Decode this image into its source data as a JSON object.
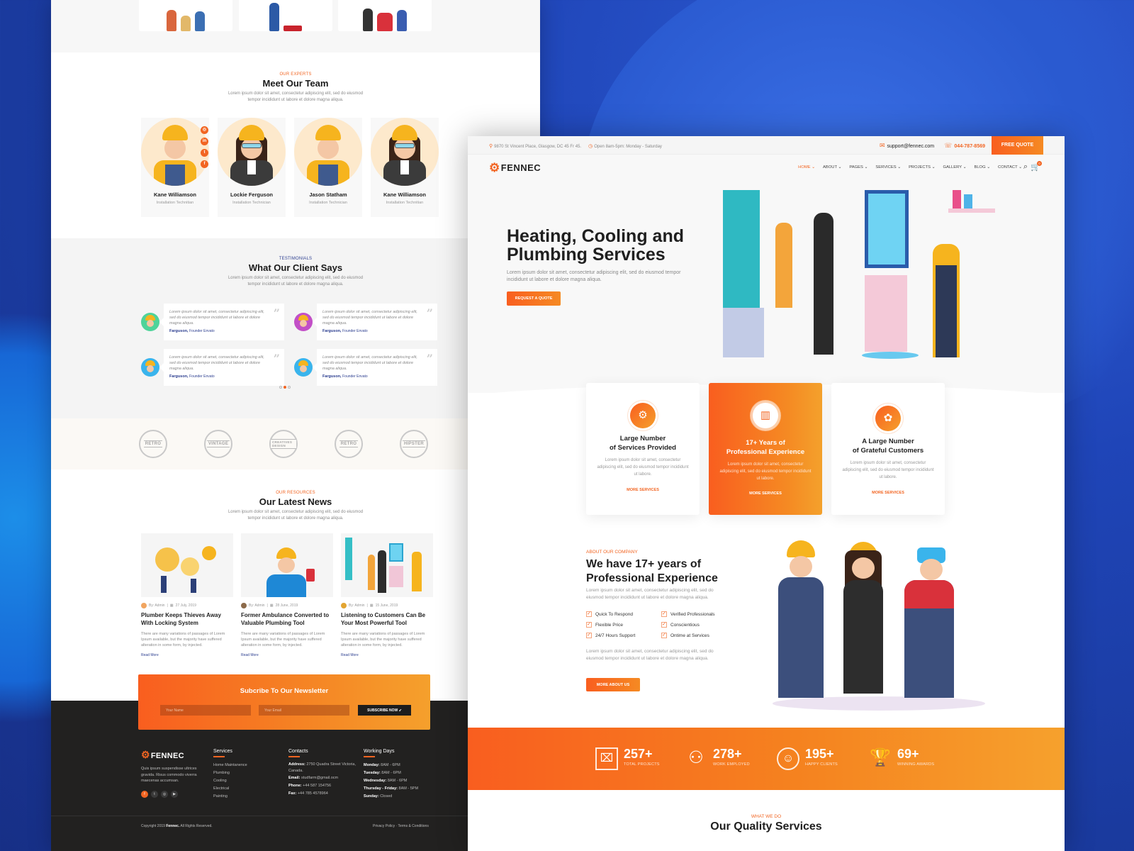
{
  "left_page": {
    "team": {
      "subtitle": "OUR EXPERTS",
      "title": "Meet Our Team",
      "description": "Lorem ipsum dolor sit amet, consectetur adipiscing elit, sed do eiusmod tempor incididunt ut labore et dolore magna aliqua.",
      "members": [
        {
          "name": "Kane Williamson",
          "role": "Installation Technitian"
        },
        {
          "name": "Lockie Ferguson",
          "role": "Installation Technician"
        },
        {
          "name": "Jason Statham",
          "role": "Installation Technician"
        },
        {
          "name": "Kane Williamson",
          "role": "Installation Technitian"
        }
      ],
      "social_icons": [
        "instagram-icon",
        "linkedin-icon",
        "twitter-icon",
        "facebook-icon"
      ]
    },
    "testimonials": {
      "subtitle": "TESTIMONIALS",
      "title": "What Our Client Says",
      "description": "Lorem ipsum dolor sit amet, consectetur adipiscing elit, sed do eiusmod tempor incididunt ut labore et dolore magna aliqua.",
      "items": [
        {
          "text": "Lorem ipsum dolor sit amet, consectetur adipiscing elit, sed do eiusmod tempor incididunt ut labore et dolore magna aliqua.",
          "author": "Farguson,",
          "company": "Founder Envato",
          "avatar_color": "#4fd39a"
        },
        {
          "text": "Lorem ipsum dolor sit amet, consectetur adipiscing elit, sed do eiusmod tempor incididunt ut labore et dolore magna aliqua.",
          "author": "Farguson,",
          "company": "Founder Envato",
          "avatar_color": "#c24fc7"
        },
        {
          "text": "Lorem ipsum dolor sit amet, consectetur adipiscing elit, sed do eiusmod tempor incididunt ut labore et dolore magna aliqua.",
          "author": "Farguson,",
          "company": "Founder Envato",
          "avatar_color": "#3ab4ec"
        },
        {
          "text": "Lorem ipsum dolor sit amet, consectetur adipiscing elit, sed do eiusmod tempor incididunt ut labore et dolore magna aliqua.",
          "author": "Farguson,",
          "company": "Founder Envato",
          "avatar_color": "#3ab4ec"
        }
      ],
      "quote_glyph": "99"
    },
    "brands": [
      "RETRO",
      "VINTAGE",
      "CREATIVES DESIGN",
      "RETRO",
      "HIPSTER"
    ],
    "news": {
      "subtitle": "OUR RESOURCES",
      "title": "Our Latest News",
      "description": "Lorem ipsum dolor sit amet, consectetur adipiscing elit, sed do eiusmod tempor incididunt ut labore et dolore magna aliqua.",
      "items": [
        {
          "author": "By: Admin",
          "date": "27 July, 2019",
          "title": "Plumber Keeps Thieves Away With Locking System",
          "excerpt": "There are many variations of passages of Lorem Ipsum available, but the majority have suffered alteration in some form, by injected.",
          "read_more": "Read More"
        },
        {
          "author": "By: Admin",
          "date": "28 June, 2019",
          "title": "Former Ambulance Converted to Valuable Plumbing Tool",
          "excerpt": "There are many variations of passages of Lorem Ipsum available, but the majority have suffered alteration in some form, by injected.",
          "read_more": "Read More"
        },
        {
          "author": "By: Admin",
          "date": "15 June, 2019",
          "title": "Listening to Customers Can Be Your Most Powerful Tool",
          "excerpt": "There are many variations of passages of Lorem Ipsum available, but the majority have suffered alteration in some form, by injected.",
          "read_more": "Read More"
        }
      ]
    },
    "newsletter": {
      "title": "Subcribe To Our Newsletter",
      "name_placeholder": "Your Name",
      "email_placeholder": "Your Email",
      "button": "SUBSCRIBE NOW"
    },
    "footer": {
      "logo": "FENNEC",
      "about": "Quis ipsum suspendisse ultrices gravida. Risus commodo viverra maecenas accumsan.",
      "social_icons": [
        "facebook-icon",
        "twitter-icon",
        "instagram-icon",
        "youtube-icon"
      ],
      "services_title": "Services",
      "services": [
        "Home Maintanence",
        "Plumbing",
        "Cooling",
        "Electrical",
        "Painting"
      ],
      "contacts_title": "Contacts",
      "contacts": [
        {
          "label": "Address:",
          "value": "2750 Quadra Street Victoria, Canada."
        },
        {
          "label": "Email:",
          "value": "studfarm@gmail.ocm"
        },
        {
          "label": "Phone:",
          "value": "+44 587 154756"
        },
        {
          "label": "Fax:",
          "value": "+44 785 4578964"
        }
      ],
      "working_title": "Working Days",
      "working": [
        {
          "label": "Monday:",
          "value": "8AM - 6PM"
        },
        {
          "label": "Tuesday:",
          "value": "8AM - 6PM"
        },
        {
          "label": "Wednesday:",
          "value": "8AM - 6PM"
        },
        {
          "label": "Thursday - Friday:",
          "value": "8AM - 5PM"
        },
        {
          "label": "Sunday:",
          "value": "Closed"
        }
      ],
      "copyright_prefix": "Copyright 2019",
      "copyright_brand": "Fennec.",
      "copyright_suffix": "All Rights Reserved.",
      "links": "Privacy Policy  ·  Terms & Conditions"
    }
  },
  "right_page": {
    "topbar": {
      "address": "9870 St Vincent Place, Glasgow, DC 45 Fr 45.",
      "hours": "Open 8am-5pm: Monday - Saturday",
      "email": "support@fennec.com",
      "phone": "044-787-8569",
      "quote_button": "FREE QUOTE"
    },
    "logo": "FENNEC",
    "nav": [
      "HOME",
      "ABOUT",
      "PAGES",
      "SERVICES",
      "PROJECTS",
      "GALLERY",
      "BLOG",
      "CONTACT"
    ],
    "nav_active": "HOME",
    "cart_count": "0",
    "hero": {
      "title_line1": "Heating, Cooling and",
      "title_line2": "Plumbing Services",
      "description": "Lorem ipsum dolor sit amet, consectetur adipiscing elit, sed do eiusmod tempor incididunt ut labore et dolore magna aliqua.",
      "button": "REQUEST A QUOTE"
    },
    "services": [
      {
        "title_line1": "Large Number",
        "title_line2": "of Services Provided",
        "description": "Lorem ipsum dolor sit amet, consectetur adipiscing elit, sed do eiusmod tempor incididunt ut labore.",
        "link": "MORE SERVICES",
        "icon": "gear-icon",
        "highlighted": false
      },
      {
        "title_line1": "17+ Years of",
        "title_line2": "Professional Experience",
        "description": "Lorem ipsum dolor sit amet, consectetur adipiscing elit, sed do eiusmod tempor incididunt ut labore.",
        "link": "MORE SERVICES",
        "icon": "building-check-icon",
        "highlighted": true
      },
      {
        "title_line1": "A Large Number",
        "title_line2": "of Grateful Customers",
        "description": "Lorem ipsum dolor sit amet, consectetur adipiscing elit, sed do eiusmod tempor incididunt ut labore.",
        "link": "MORE SERVICES",
        "icon": "hand-gear-icon",
        "highlighted": false
      }
    ],
    "about": {
      "subtitle": "ABOUT OUR COMPANY",
      "title_line1": "We have 17+ years of",
      "title_line2": "Professional Experience",
      "description1": "Lorem ipsum dolor sit amet, consectetur adipiscing elit, sed do eiusmod tempor incididunt ut labore et dolore magna aliqua.",
      "features": [
        "Quick To Respond",
        "Verified Professionals",
        "Flexible Price",
        "Conscientious",
        "24/7 Hours Support",
        "Ontime at Services"
      ],
      "description2": "Lorem ipsum dolor sit amet, consectetur adipiscing elit, sed do eiusmod tempor incididunt ut labore et dolore magna aliqua.",
      "button": "MORE ABOUT US"
    },
    "counters": [
      {
        "value": "257+",
        "label": "TOTAL PROJECTS",
        "icon": "briefcase-icon"
      },
      {
        "value": "278+",
        "label": "WORK EMPLOYED",
        "icon": "user-icon"
      },
      {
        "value": "195+",
        "label": "HAPPY CLIENTS",
        "icon": "smiley-icon"
      },
      {
        "value": "69+",
        "label": "WINNING AWARDS",
        "icon": "trophy-icon"
      }
    ],
    "what_we_do": {
      "subtitle": "WHAT WE DO",
      "title": "Our Quality Services"
    }
  },
  "colors": {
    "accent": "#f26522",
    "accent_end": "#f5a02c",
    "navy": "#2b3d8f",
    "footer_bg": "#222120",
    "backdrop": "#1f45b8"
  }
}
